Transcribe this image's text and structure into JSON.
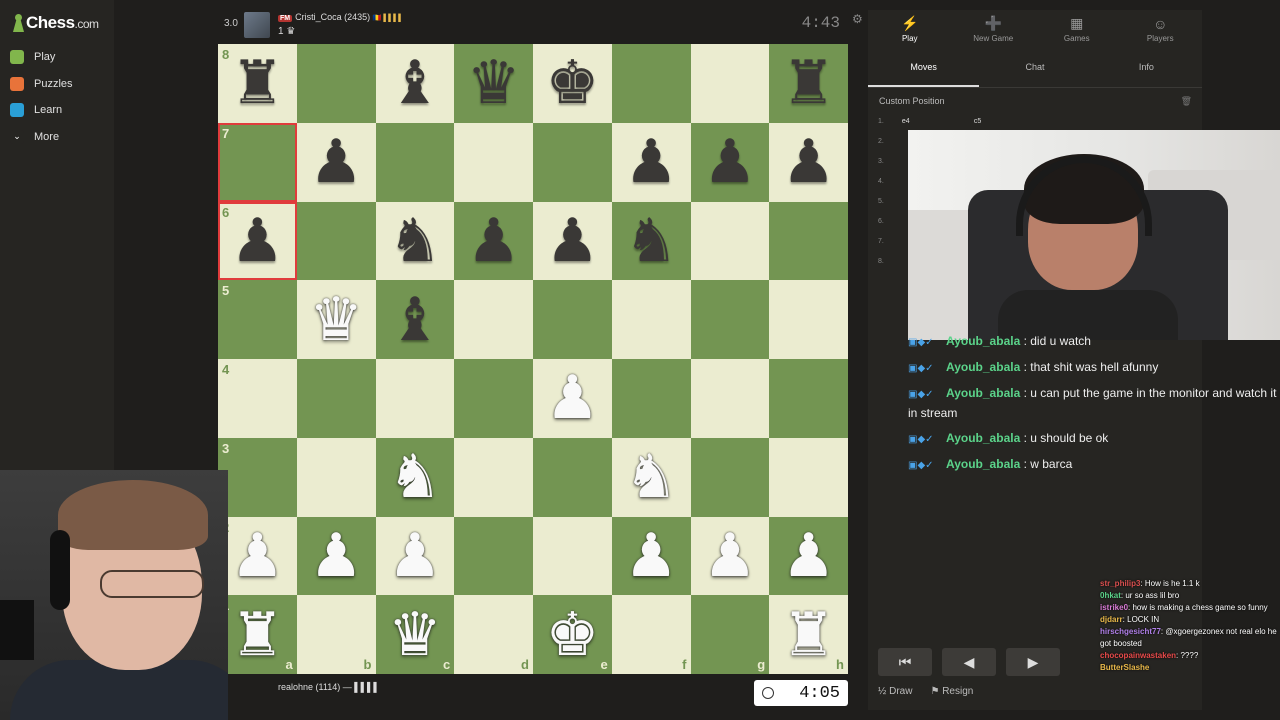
{
  "sidebar": {
    "logo_main": "Chess",
    "logo_suffix": ".com",
    "items": [
      {
        "label": "Play",
        "color": "#81b64c",
        "icon": "play-icon"
      },
      {
        "label": "Puzzles",
        "color": "#e8733a",
        "icon": "puzzle-icon"
      },
      {
        "label": "Learn",
        "color": "#2a9fd6",
        "icon": "learn-icon"
      },
      {
        "label": "More",
        "color": "#262522",
        "icon": "chevron-down-icon"
      }
    ]
  },
  "opponent": {
    "rating_score": "3.0",
    "title": "FM",
    "name": "Cristi_Coca (2435)",
    "flags": "🇷🇴 ▌▌▌▌",
    "sub": "1 ♛",
    "clock": "4:43"
  },
  "player": {
    "name": "realohne (1114) — ▌▌▌▌",
    "clock": "4:05"
  },
  "board": {
    "files": [
      "a",
      "b",
      "c",
      "d",
      "e",
      "f",
      "g",
      "h"
    ],
    "ranks": [
      "8",
      "7",
      "6",
      "5",
      "4",
      "3",
      "2",
      "1"
    ],
    "highlight": [
      "a7",
      "a6"
    ],
    "position": [
      [
        "br",
        "",
        "bb",
        "bq",
        "bk",
        "",
        "",
        "br"
      ],
      [
        "",
        "bp",
        "",
        "",
        "",
        "bp",
        "bp",
        "bp"
      ],
      [
        "bp",
        "",
        "bn",
        "bp",
        "bp",
        "bn",
        "",
        ""
      ],
      [
        "",
        "wq",
        "bb",
        "",
        "",
        "",
        "",
        ""
      ],
      [
        "",
        "",
        "",
        "",
        "wp",
        "",
        "",
        ""
      ],
      [
        "",
        "",
        "wn",
        "",
        "",
        "wn",
        "",
        ""
      ],
      [
        "wp",
        "wp",
        "wp",
        "",
        "",
        "wp",
        "wp",
        "wp"
      ],
      [
        "wr",
        "",
        "wq",
        "",
        "wk",
        "",
        "",
        "wr"
      ]
    ]
  },
  "panel": {
    "nav": [
      {
        "label": "Play",
        "icon": "⚡"
      },
      {
        "label": "New Game",
        "icon": "➕"
      },
      {
        "label": "Games",
        "icon": "▦"
      },
      {
        "label": "Players",
        "icon": "☺"
      }
    ],
    "tabs": [
      "Moves",
      "Chat",
      "Info"
    ],
    "custom_position": "Custom Position",
    "moves": [
      {
        "n": "1.",
        "w": "e4",
        "b": "c5"
      },
      {
        "n": "2.",
        "w": "",
        "b": ""
      },
      {
        "n": "3.",
        "w": "",
        "b": ""
      },
      {
        "n": "4.",
        "w": "",
        "b": ""
      },
      {
        "n": "5.",
        "w": "",
        "b": ""
      },
      {
        "n": "6.",
        "w": "",
        "b": ""
      },
      {
        "n": "7.",
        "w": "",
        "b": ""
      },
      {
        "n": "8.",
        "w": "",
        "b": ""
      }
    ],
    "draw_label": "½ Draw",
    "resign_label": "⚑ Resign"
  },
  "chat": [
    {
      "user": "Ayoub_abala",
      "text": " : did u watch "
    },
    {
      "user": "Ayoub_abala",
      "text": " : that shit was hell afunny"
    },
    {
      "user": "Ayoub_abala",
      "text": " : u can put the game in the monitor and watch it in stream"
    },
    {
      "user": "Ayoub_abala",
      "text": " : u should be ok"
    },
    {
      "user": "Ayoub_abala",
      "text": " : w barca"
    }
  ],
  "mini_chat": [
    {
      "user": "str_philip3",
      "text": ": How is he 1.1 k",
      "color": "#d94f4f"
    },
    {
      "user": "0hkat",
      "text": ": ur so ass lil bro",
      "color": "#5bd38a"
    },
    {
      "user": "istrike0",
      "text": ": how is making a chess game so funny",
      "color": "#d97bd6"
    },
    {
      "user": "djdarr",
      "text": ": LOCK IN",
      "color": "#e8b84a"
    },
    {
      "user": "hirschgesicht77",
      "text": ": @xgoergezonex not real elo he got boosted",
      "color": "#b07fe8"
    },
    {
      "user": "chocopainwastaken",
      "text": ": ????",
      "color": "#e84a4a"
    },
    {
      "user": "ButterSlashe",
      "text": "",
      "color": "#e8b84a"
    }
  ]
}
